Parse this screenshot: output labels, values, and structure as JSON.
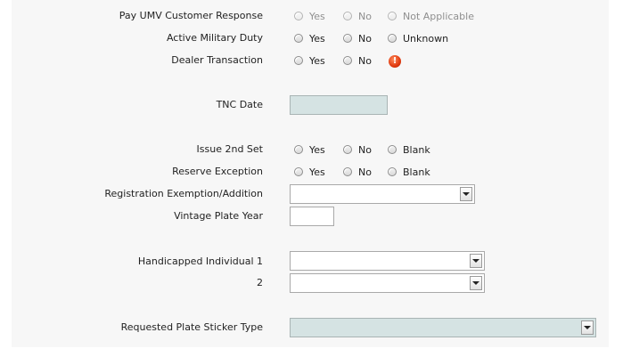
{
  "fields": {
    "pay_umv": {
      "label": "Pay UMV Customer Response",
      "options": [
        "Yes",
        "No",
        "Not Applicable"
      ],
      "disabled": true
    },
    "active_military": {
      "label": "Active Military Duty",
      "options": [
        "Yes",
        "No",
        "Unknown"
      ]
    },
    "dealer_transaction": {
      "label": "Dealer Transaction",
      "options": [
        "Yes",
        "No"
      ],
      "error_icon": "exclamation-icon",
      "error_glyph": "!"
    },
    "tnc_date": {
      "label": "TNC Date",
      "value": ""
    },
    "issue_2nd_set": {
      "label": "Issue 2nd Set",
      "options": [
        "Yes",
        "No",
        "Blank"
      ]
    },
    "reserve_exception": {
      "label": "Reserve Exception",
      "options": [
        "Yes",
        "No",
        "Blank"
      ]
    },
    "registration_exemption": {
      "label": "Registration Exemption/Addition",
      "value": ""
    },
    "vintage_plate_year": {
      "label": "Vintage Plate Year",
      "value": ""
    },
    "handicapped_1": {
      "label": "Handicapped Individual 1",
      "value": ""
    },
    "handicapped_2": {
      "label": "2",
      "value": ""
    },
    "plate_sticker_type": {
      "label": "Requested Plate Sticker Type",
      "value": ""
    }
  },
  "colors": {
    "panel_bg": "#f7f7f7",
    "readonly_bg": "#d5e3e3",
    "error": "#e03a10"
  }
}
